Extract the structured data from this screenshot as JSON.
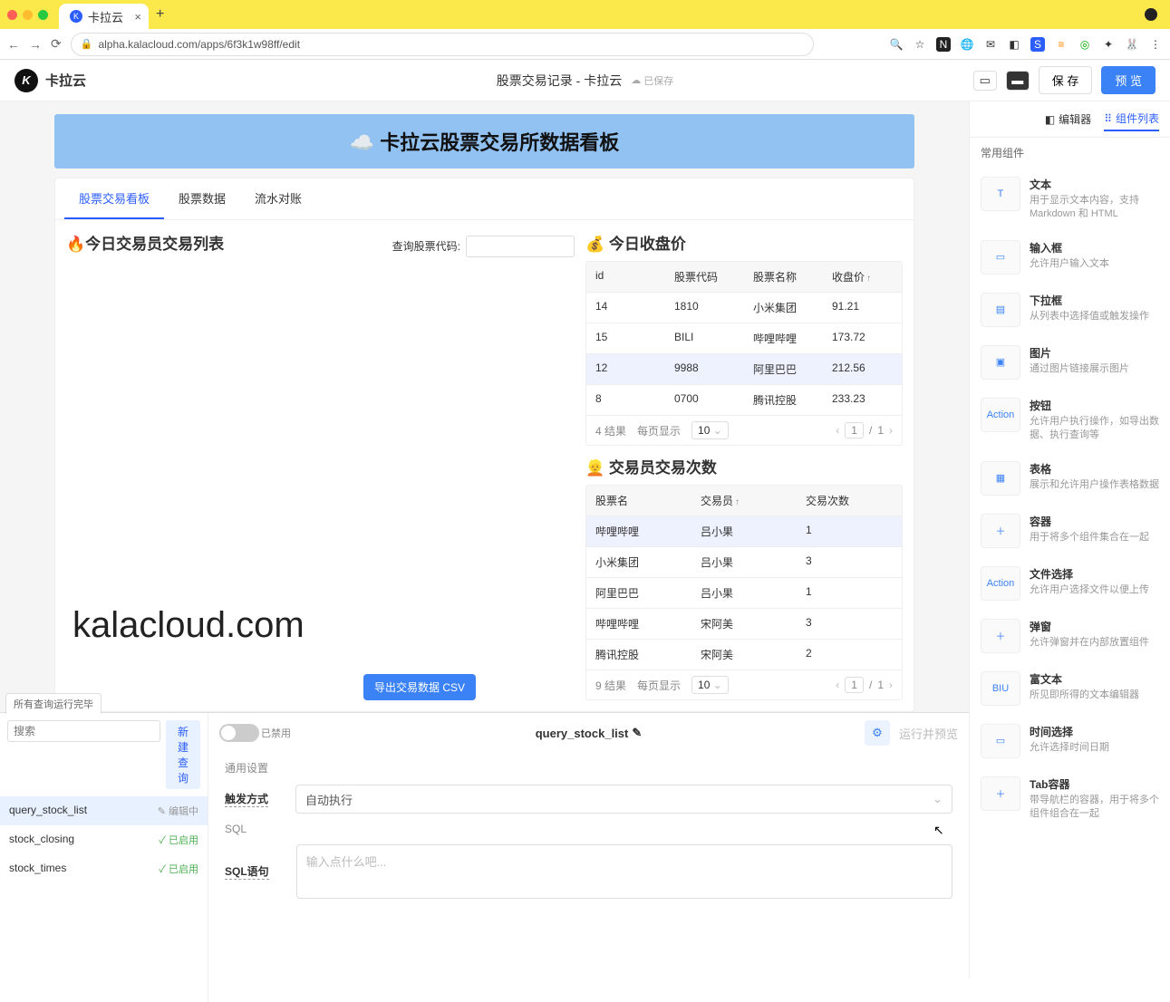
{
  "browser": {
    "tab_title": "卡拉云",
    "url": "alpha.kalacloud.com/apps/6f3k1w98ff/edit"
  },
  "header": {
    "logo_text": "卡拉云",
    "app_title": "股票交易记录 - 卡拉云",
    "saved_label": "已保存",
    "save_btn": "保 存",
    "preview_btn": "预 览"
  },
  "banner": "☁️ 卡拉云股票交易所数据看板",
  "tabs": [
    "股票交易看板",
    "股票数据",
    "流水对账"
  ],
  "left_section": {
    "title": "🔥今日交易员交易列表",
    "query_label": "查询股票代码:",
    "export_btn": "导出交易数据 CSV"
  },
  "closing_price": {
    "title": "💰 今日收盘价",
    "columns": [
      "id",
      "股票代码",
      "股票名称",
      "收盘价"
    ],
    "rows": [
      {
        "id": "14",
        "code": "1810",
        "name": "小米集团",
        "price": "91.21"
      },
      {
        "id": "15",
        "code": "BILI",
        "name": "哔哩哔哩",
        "price": "173.72"
      },
      {
        "id": "12",
        "code": "9988",
        "name": "阿里巴巴",
        "price": "212.56",
        "hl": true
      },
      {
        "id": "8",
        "code": "0700",
        "name": "腾讯控股",
        "price": "233.23"
      }
    ],
    "results": "4 结果",
    "per_page_label": "每页显示",
    "per_page": "10",
    "page": "1",
    "total_pages": "1"
  },
  "trader_times": {
    "title": "👱 交易员交易次数",
    "columns": [
      "股票名",
      "交易员",
      "交易次数"
    ],
    "rows": [
      {
        "stock": "哔哩哔哩",
        "trader": "吕小果",
        "count": "1",
        "hl": true
      },
      {
        "stock": "小米集团",
        "trader": "吕小果",
        "count": "3"
      },
      {
        "stock": "阿里巴巴",
        "trader": "吕小果",
        "count": "1"
      },
      {
        "stock": "哔哩哔哩",
        "trader": "宋阿美",
        "count": "3"
      },
      {
        "stock": "腾讯控股",
        "trader": "宋阿美",
        "count": "2"
      }
    ],
    "results": "9 结果",
    "per_page_label": "每页显示",
    "per_page": "10",
    "page": "1",
    "total_pages": "1"
  },
  "watermark": "kalacloud.com",
  "query_panel": {
    "run_status": "所有查询运行完毕",
    "search_placeholder": "搜索",
    "new_query": "新建查询",
    "queries": [
      {
        "name": "query_stock_list",
        "status": "编辑中",
        "editing": true
      },
      {
        "name": "stock_closing",
        "status": "已启用"
      },
      {
        "name": "stock_times",
        "status": "已启用"
      }
    ],
    "disabled_label": "已禁用",
    "query_name": "query_stock_list",
    "run_preview": "运行并预览",
    "general_label": "通用设置",
    "trigger_label": "触发方式",
    "trigger_value": "自动执行",
    "sql_label": "SQL",
    "sql_stmt_label": "SQL语句",
    "sql_placeholder": "输入点什么吧..."
  },
  "right_panel": {
    "tab_editor": "编辑器",
    "tab_components": "组件列表",
    "section_title": "常用组件",
    "components": [
      {
        "icon": "T",
        "title": "文本",
        "desc": "用于显示文本内容，支持 Markdown 和 HTML"
      },
      {
        "icon": "▭",
        "title": "输入框",
        "desc": "允许用户输入文本"
      },
      {
        "icon": "▤",
        "title": "下拉框",
        "desc": "从列表中选择值或触发操作"
      },
      {
        "icon": "▣",
        "title": "图片",
        "desc": "通过图片链接展示图片"
      },
      {
        "icon": "Action",
        "title": "按钮",
        "desc": "允许用户执行操作，如导出数据、执行查询等"
      },
      {
        "icon": "▦",
        "title": "表格",
        "desc": "展示和允许用户操作表格数据"
      },
      {
        "icon": "＋",
        "title": "容器",
        "desc": "用于将多个组件集合在一起"
      },
      {
        "icon": "Action",
        "title": "文件选择",
        "desc": "允许用户选择文件以便上传"
      },
      {
        "icon": "＋",
        "title": "弹窗",
        "desc": "允许弹窗并在内部放置组件"
      },
      {
        "icon": "BIU",
        "title": "富文本",
        "desc": "所见即所得的文本编辑器"
      },
      {
        "icon": "▭",
        "title": "时间选择",
        "desc": "允许选择时间日期"
      },
      {
        "icon": "＋",
        "title": "Tab容器",
        "desc": "带导航栏的容器，用于将多个组件组合在一起"
      }
    ]
  }
}
